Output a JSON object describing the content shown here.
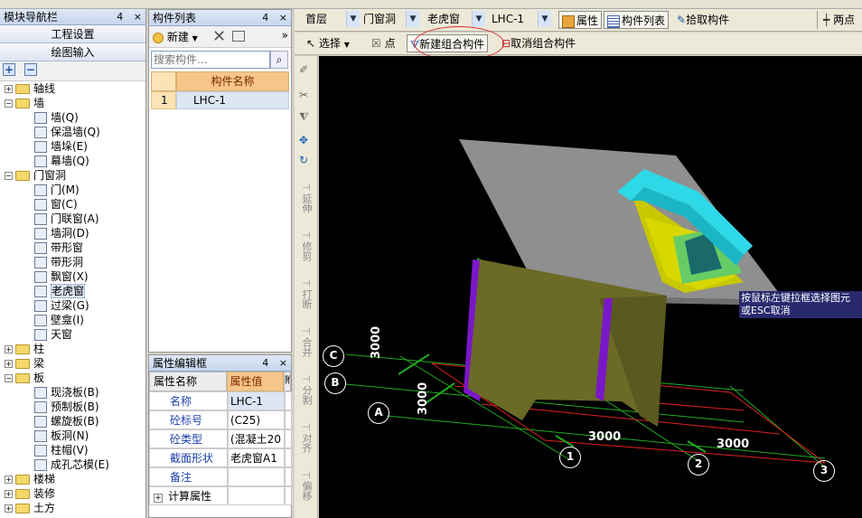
{
  "nav": {
    "title": "模块导航栏",
    "pin": "4",
    "close": "×",
    "btn_project": "工程设置",
    "btn_drawing": "绘图输入",
    "add": "+",
    "remove": "−",
    "tree": [
      {
        "label": "轴线",
        "level": 0,
        "expanded": false
      },
      {
        "label": "墙",
        "level": 0,
        "expanded": true
      },
      {
        "label": "墙(Q)",
        "level": 1
      },
      {
        "label": "保温墙(Q)",
        "level": 1
      },
      {
        "label": "墙垛(E)",
        "level": 1
      },
      {
        "label": "幕墙(Q)",
        "level": 1
      },
      {
        "label": "门窗洞",
        "level": 0,
        "expanded": true
      },
      {
        "label": "门(M)",
        "level": 1
      },
      {
        "label": "窗(C)",
        "level": 1
      },
      {
        "label": "门联窗(A)",
        "level": 1
      },
      {
        "label": "墙洞(D)",
        "level": 1
      },
      {
        "label": "带形窗",
        "level": 1
      },
      {
        "label": "带形洞",
        "level": 1
      },
      {
        "label": "飘窗(X)",
        "level": 1
      },
      {
        "label": "老虎窗",
        "level": 1,
        "selected": true
      },
      {
        "label": "过梁(G)",
        "level": 1
      },
      {
        "label": "壁龛(I)",
        "level": 1
      },
      {
        "label": "天窗",
        "level": 1
      },
      {
        "label": "柱",
        "level": 0,
        "expanded": false
      },
      {
        "label": "梁",
        "level": 0,
        "expanded": false
      },
      {
        "label": "板",
        "level": 0,
        "expanded": true
      },
      {
        "label": "现浇板(B)",
        "level": 1
      },
      {
        "label": "预制板(B)",
        "level": 1
      },
      {
        "label": "螺旋板(B)",
        "level": 1
      },
      {
        "label": "板洞(N)",
        "level": 1
      },
      {
        "label": "柱帽(V)",
        "level": 1
      },
      {
        "label": "成孔芯模(E)",
        "level": 1
      },
      {
        "label": "楼梯",
        "level": 0,
        "expanded": false
      },
      {
        "label": "装修",
        "level": 0,
        "expanded": false
      },
      {
        "label": "土方",
        "level": 0,
        "expanded": false
      }
    ]
  },
  "component_list": {
    "title": "构件列表",
    "pin": "4",
    "close": "×",
    "new_label": "新建",
    "more": "»",
    "search_placeholder": "搜索构件...",
    "col_header": "构件名称",
    "rows": [
      {
        "num": "1",
        "name": "LHC-1"
      }
    ]
  },
  "props": {
    "title": "属性编辑框",
    "pin": "4",
    "close": "×",
    "col_name": "属性名称",
    "col_value": "属性值",
    "col_extra": "附",
    "rows": [
      {
        "name": "名称",
        "value": "LHC-1"
      },
      {
        "name": "砼标号",
        "value": "(C25)"
      },
      {
        "name": "砼类型",
        "value": "(混凝土20"
      },
      {
        "name": "截面形状",
        "value": "老虎窗A1"
      },
      {
        "name": "备注",
        "value": ""
      },
      {
        "name": "计算属性",
        "value": "",
        "expander": "+"
      }
    ]
  },
  "toolbar": {
    "floor": "首层",
    "category": "门窗洞",
    "type": "老虎窗",
    "component": "LHC-1",
    "attr_label": "属性",
    "list_label": "构件列表",
    "pick_label": "拾取构件",
    "twopoint_label": "两点",
    "select_label": "选择",
    "point_label": "点",
    "new_group_label": "新建组合构件",
    "cancel_group_label": "取消组合构件"
  },
  "vtools": [
    "延伸",
    "修剪",
    "打断",
    "合并",
    "分割",
    "对齐",
    "偏移"
  ],
  "viewport": {
    "tooltip_line1": "按鼠标左键拉框选择图元",
    "tooltip_line2": "或ESC取消",
    "axis_labels": [
      "C",
      "B",
      "A",
      "1",
      "2",
      "3"
    ],
    "dims": [
      "3000",
      "3000",
      "3000",
      "3000"
    ]
  },
  "colors": {
    "accent": "#ff8c00",
    "panel_bg": "#d4d0c8",
    "title_bg": "#c7d6ee",
    "viewport_bg": "#000000",
    "grid_red": "#e02020",
    "grid_green": "#22aa22"
  }
}
